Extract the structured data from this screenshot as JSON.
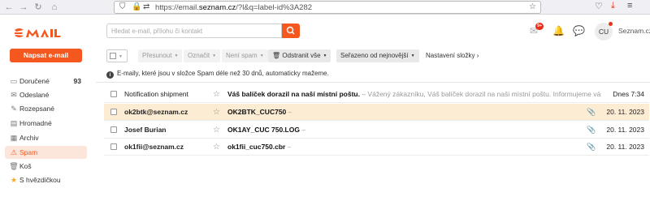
{
  "browser": {
    "url_prefix": "https://email.",
    "url_domain": "seznam.cz",
    "url_suffix": "/?l&q=label-id%3A282"
  },
  "sidebar": {
    "compose_label": "Napsat e-mail",
    "folders": [
      {
        "icon": "inbox-icon",
        "label": "Doručené",
        "count": "93"
      },
      {
        "icon": "sent-icon",
        "label": "Odeslané",
        "count": ""
      },
      {
        "icon": "draft-icon",
        "label": "Rozepsané",
        "count": ""
      },
      {
        "icon": "bulk-icon",
        "label": "Hromadné",
        "count": ""
      },
      {
        "icon": "archive-icon",
        "label": "Archiv",
        "count": ""
      },
      {
        "icon": "spam-icon",
        "label": "Spam",
        "count": ""
      },
      {
        "icon": "trash-icon",
        "label": "Koš",
        "count": ""
      },
      {
        "icon": "star-icon",
        "label": "S hvězdičkou",
        "count": ""
      }
    ]
  },
  "search": {
    "placeholder": "Hledat e-mail, přílohu či kontakt"
  },
  "header": {
    "badge": "9+",
    "avatar_initials": "CU",
    "account": "Seznam.cz"
  },
  "toolbar": {
    "move": "Přesunout",
    "mark": "Označit",
    "not_spam": "Není spam",
    "delete_all": "Odstranit vše",
    "sort": "Seřazeno od nejnovější",
    "folder_settings": "Nastavení složky"
  },
  "info_text": "E-maily, které jsou v složce Spam déle než 30 dnů, automaticky mažeme.",
  "emails": [
    {
      "sender": "Notification shipment",
      "subject": "Váš balíček dorazil na naší místní poštu.",
      "preview": " – Vážený zákazníku, Váš balíček dorazil na naši místní poštu. Informujeme vás, že odesílatel…",
      "date": "Dnes 7:34",
      "attachment": false,
      "bold": false
    },
    {
      "sender": "ok2btk@seznam.cz",
      "subject": "OK2BTK_CUC750",
      "preview": " –",
      "date": "20. 11. 2023",
      "attachment": true,
      "bold": true
    },
    {
      "sender": "Josef Burian",
      "subject": "OK1AY_CUC 750.LOG",
      "preview": " –",
      "date": "20. 11. 2023",
      "attachment": true,
      "bold": true
    },
    {
      "sender": "ok1fii@seznam.cz",
      "subject": "ok1fii_cuc750.cbr",
      "preview": " –",
      "date": "20. 11. 2023",
      "attachment": true,
      "bold": true
    }
  ]
}
